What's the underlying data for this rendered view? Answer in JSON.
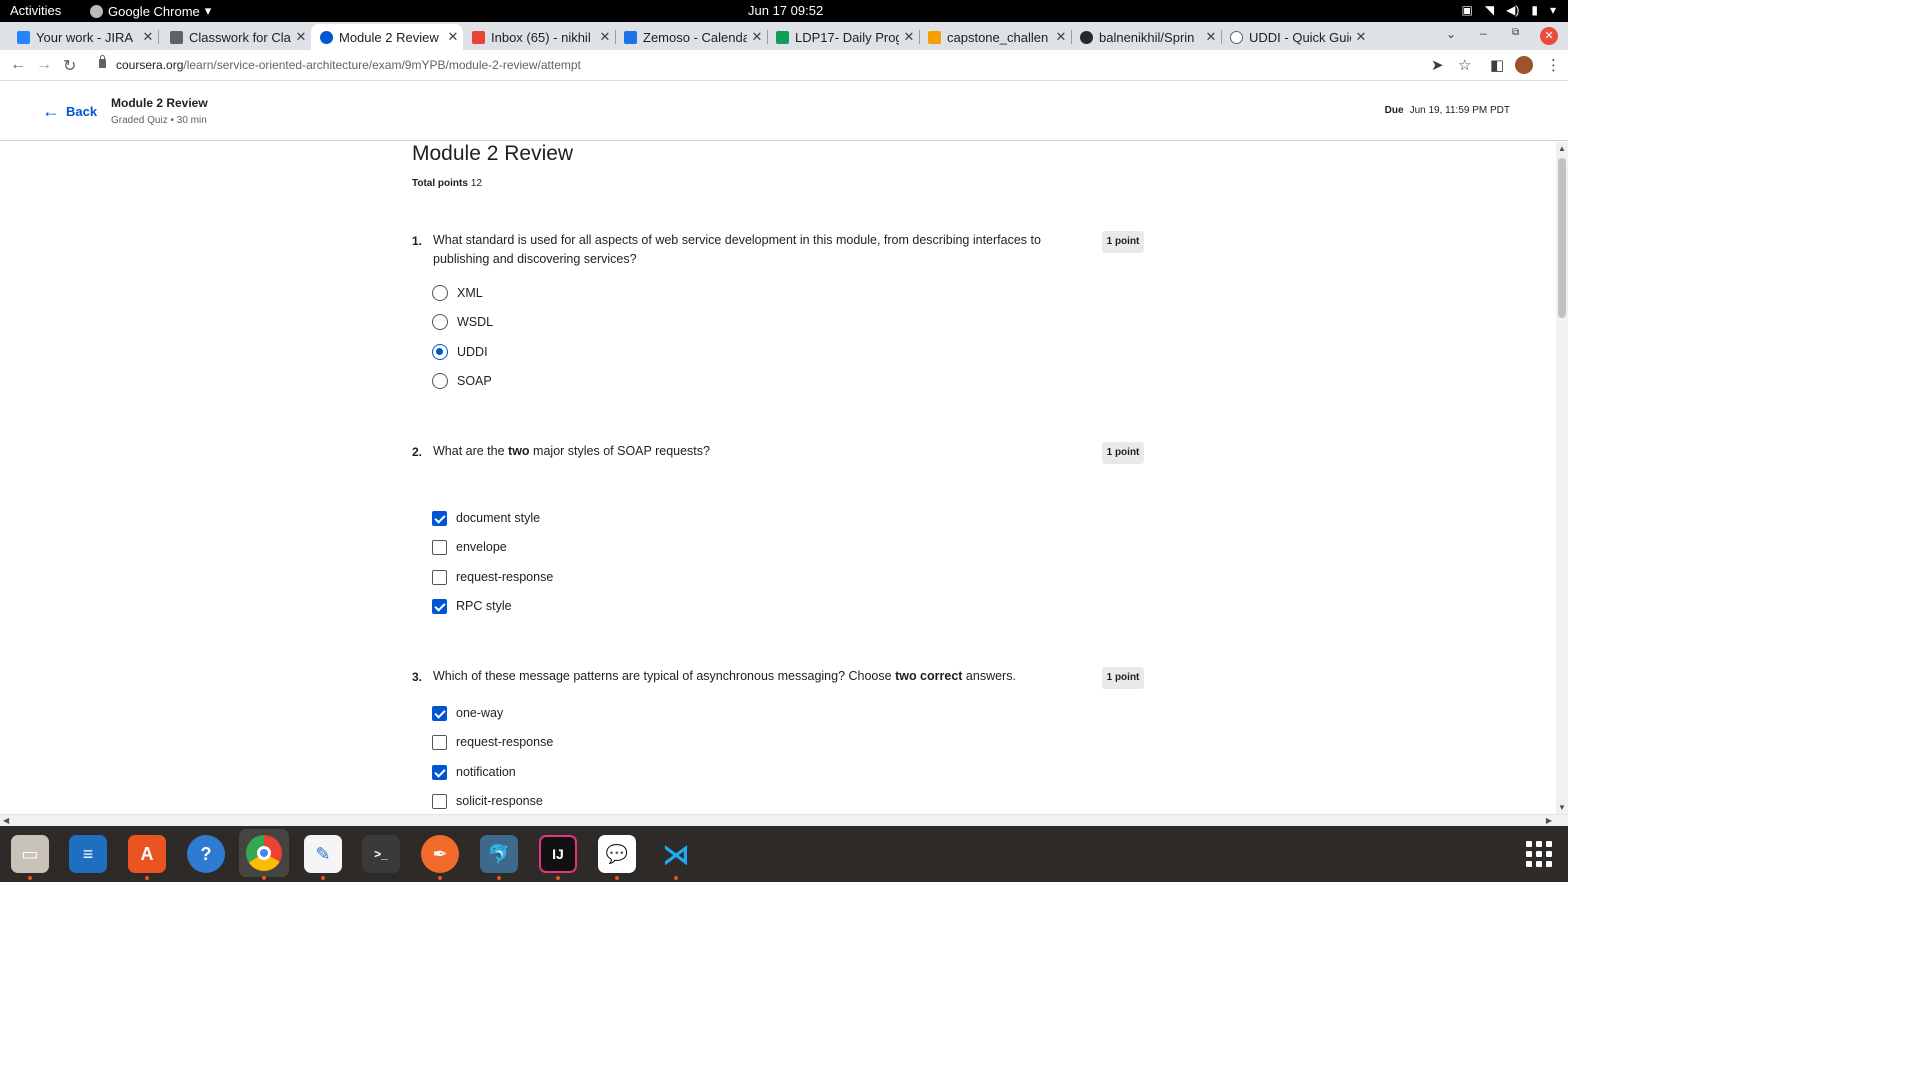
{
  "system": {
    "activities": "Activities",
    "app_name": "Google Chrome",
    "clock": "Jun 17  09:52"
  },
  "tabs": [
    {
      "title": "Your work - JIRA",
      "color": "#2684ff"
    },
    {
      "title": "Classwork for Cla",
      "color": "#5f6368"
    },
    {
      "title": "Module 2 Review |",
      "color": "#0056d2"
    },
    {
      "title": "Inbox (65) - nikhil",
      "color": "#ea4335"
    },
    {
      "title": "Zemoso - Calenda",
      "color": "#1a73e8"
    },
    {
      "title": "LDP17- Daily Prog",
      "color": "#0f9d58"
    },
    {
      "title": "capstone_challen",
      "color": "#f4a100"
    },
    {
      "title": "balnenikhil/Sprin",
      "color": "#24292e"
    },
    {
      "title": "UDDI - Quick Guid",
      "color": "#5f6368"
    }
  ],
  "address": {
    "host": "coursera.org",
    "path": "/learn/service-oriented-architecture/exam/9mYPB/module-2-review/attempt"
  },
  "header": {
    "back_label": "Back",
    "quiz_title": "Module 2 Review",
    "quiz_subtitle": "Graded Quiz • 30 min",
    "due_label": "Due",
    "due_value": "Jun 19, 11:59 PM PDT"
  },
  "page": {
    "title": "Module 2 Review",
    "total_points_label": "Total points",
    "total_points_value": "12"
  },
  "questions": [
    {
      "number": "1.",
      "text_before": "What standard is used for all aspects of web service development in this module, from describing interfaces to publishing and discovering services?",
      "points": "1 point",
      "type": "radio",
      "options": [
        {
          "label": "XML",
          "selected": false
        },
        {
          "label": "WSDL",
          "selected": false
        },
        {
          "label": "UDDI",
          "selected": true
        },
        {
          "label": "SOAP",
          "selected": false
        }
      ]
    },
    {
      "number": "2.",
      "text_before": "What are the ",
      "text_bold": "two",
      "text_after": " major styles of SOAP requests?",
      "points": "1 point",
      "type": "checkbox",
      "options": [
        {
          "label": "document style",
          "selected": true
        },
        {
          "label": "envelope",
          "selected": false
        },
        {
          "label": "request-response",
          "selected": false
        },
        {
          "label": "RPC style",
          "selected": true
        }
      ]
    },
    {
      "number": "3.",
      "text_before": "Which of these message patterns are typical of asynchronous messaging? Choose ",
      "text_bold": "two correct",
      "text_after": " answers.",
      "points": "1 point",
      "type": "checkbox",
      "options": [
        {
          "label": "one-way",
          "selected": true
        },
        {
          "label": "request-response",
          "selected": false
        },
        {
          "label": "notification",
          "selected": true
        },
        {
          "label": "solicit-response",
          "selected": false
        }
      ]
    }
  ],
  "dock": [
    "files-icon",
    "writer-icon",
    "software-icon",
    "help-icon",
    "chrome-icon",
    "text-editor-icon",
    "terminal-icon",
    "inkscape-icon",
    "mysql-workbench-icon",
    "intellij-icon",
    "chat-icon",
    "vscode-icon"
  ]
}
